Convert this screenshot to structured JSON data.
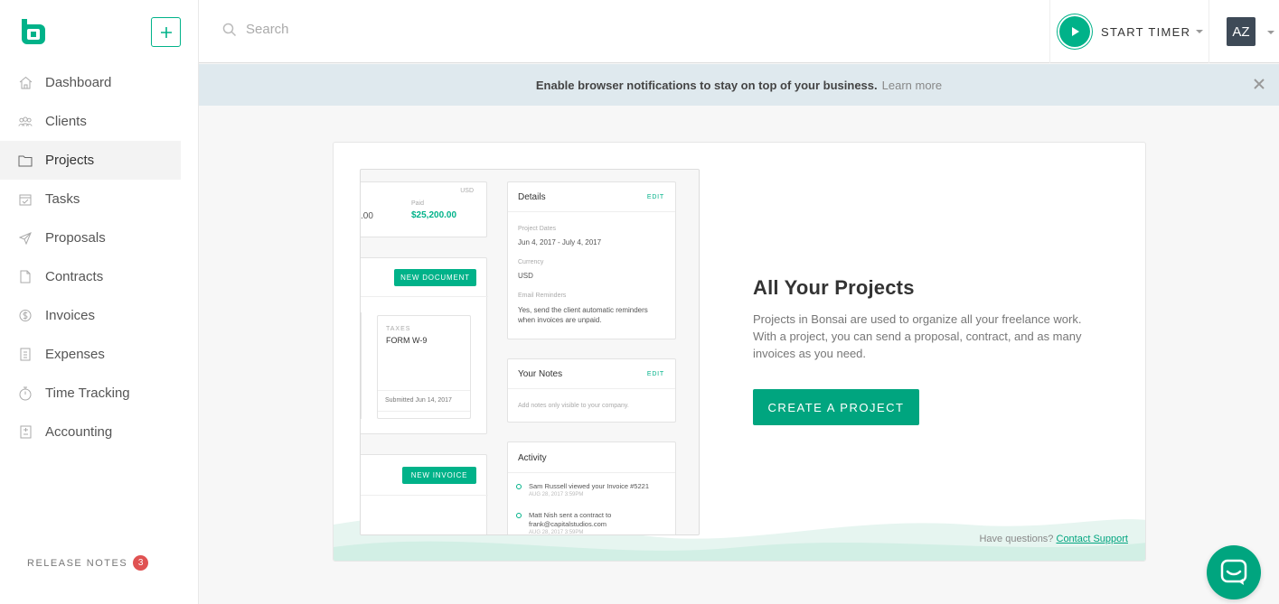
{
  "sidebar": {
    "items": [
      {
        "label": "Dashboard",
        "icon": "home-icon"
      },
      {
        "label": "Clients",
        "icon": "clients-icon"
      },
      {
        "label": "Projects",
        "icon": "folder-icon"
      },
      {
        "label": "Tasks",
        "icon": "tasks-icon"
      },
      {
        "label": "Proposals",
        "icon": "paper-plane-icon"
      },
      {
        "label": "Contracts",
        "icon": "contract-icon"
      },
      {
        "label": "Invoices",
        "icon": "dollar-icon"
      },
      {
        "label": "Expenses",
        "icon": "receipt-icon"
      },
      {
        "label": "Time Tracking",
        "icon": "stopwatch-icon"
      },
      {
        "label": "Accounting",
        "icon": "ledger-icon"
      }
    ],
    "active": "Projects",
    "release_notes_label": "RELEASE NOTES",
    "release_notes_count": "3"
  },
  "topbar": {
    "search_placeholder": "Search",
    "timer_label": "START TIMER",
    "avatar_initials": "AZ"
  },
  "banner": {
    "message": "Enable browser notifications to stay on top of your business.",
    "link": "Learn more"
  },
  "card": {
    "title": "All Your Projects",
    "description": "Projects in Bonsai are used to organize all your freelance work. With a project, you can send a proposal, contract, and as many invoices as you need.",
    "cta": "CREATE A PROJECT",
    "help_text": "Have questions?",
    "help_link": "Contact Support"
  },
  "mockup": {
    "currency_select": "USD",
    "amount_left": ".00",
    "paid_label": "Paid",
    "paid_value": "$25,200.00",
    "new_document": "NEW DOCUMENT",
    "doc_category": "TAXES",
    "doc_title": "FORM W-9",
    "doc_submitted": "Submitted Jun 14, 2017",
    "new_invoice": "NEW INVOICE",
    "details_title": "Details",
    "edit": "EDIT",
    "project_dates_label": "Project Dates",
    "project_dates_value": "Jun 4, 2017 - July 4, 2017",
    "currency_label": "Currency",
    "currency_value": "USD",
    "email_reminders_label": "Email Reminders",
    "email_reminders_value": "Yes, send the client automatic reminders when invoices are unpaid.",
    "notes_title": "Your Notes",
    "notes_placeholder": "Add notes only visible to your company.",
    "activity_title": "Activity",
    "activity_1": "Sam Russell viewed your Invoice #5221",
    "activity_1_date": "AUG 28, 2017 3:59PM",
    "activity_2a": "Matt Nish sent a contract to",
    "activity_2b": "frank@capitalstudios.com",
    "activity_2_date": "AUG 28, 2017 3:59PM"
  },
  "colors": {
    "brand": "#00b289",
    "badge": "#e05252",
    "banner_bg": "#dfe9ee"
  }
}
